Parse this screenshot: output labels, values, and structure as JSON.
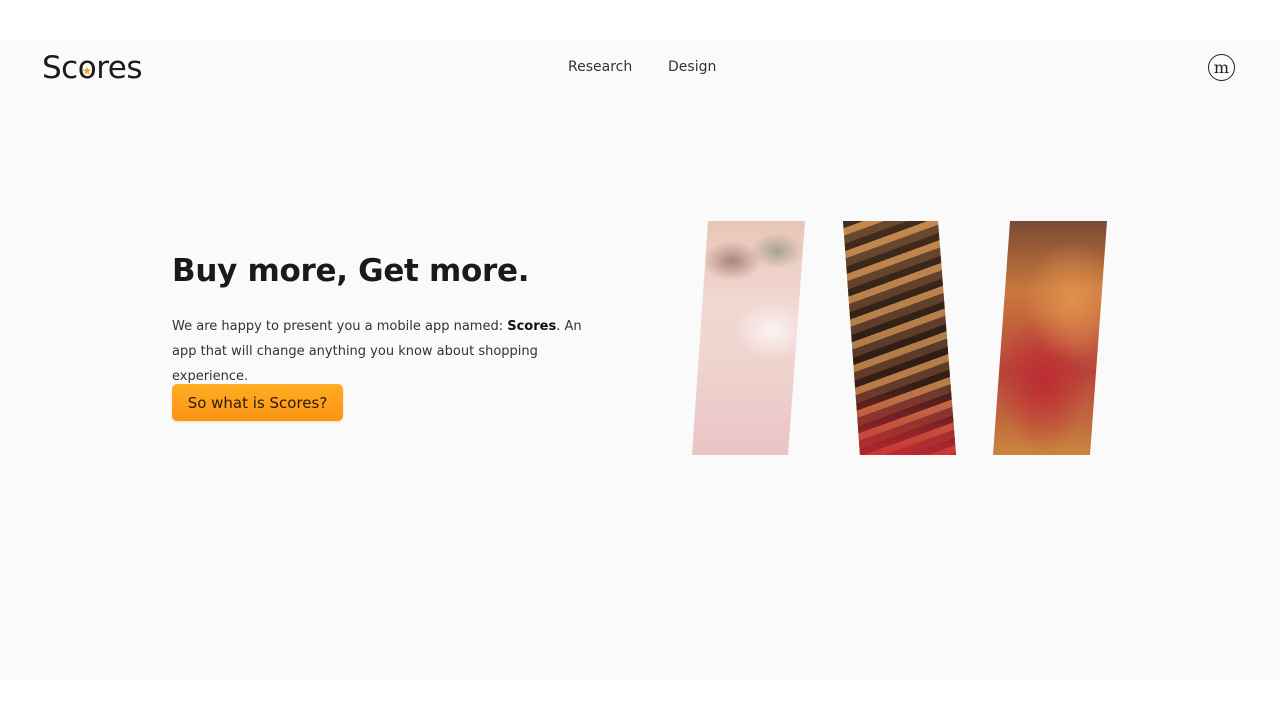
{
  "header": {
    "logo_text_before": "Sc",
    "logo_o": "o",
    "logo_text_after": "res",
    "nav": [
      {
        "label": "Research"
      },
      {
        "label": "Design"
      }
    ],
    "brand_mark": "m"
  },
  "hero": {
    "title": "Buy more, Get more.",
    "text_before": "We are happy to present you a mobile app named: ",
    "text_bold": "Scores",
    "text_after": ". An app that will change anything you know about shopping experience.",
    "cta_label": "So what is Scores?"
  },
  "images": [
    {
      "subject": "blurred-store-interior"
    },
    {
      "subject": "clothing-rack"
    },
    {
      "subject": "clothing-rack-closeup"
    }
  ],
  "colors": {
    "accent": "#fb9413",
    "page_background": "#fafafa",
    "star": "#f5a01c"
  },
  "icons": {
    "logo_star": "star-icon",
    "brand_mark": "brand-logo-icon"
  }
}
